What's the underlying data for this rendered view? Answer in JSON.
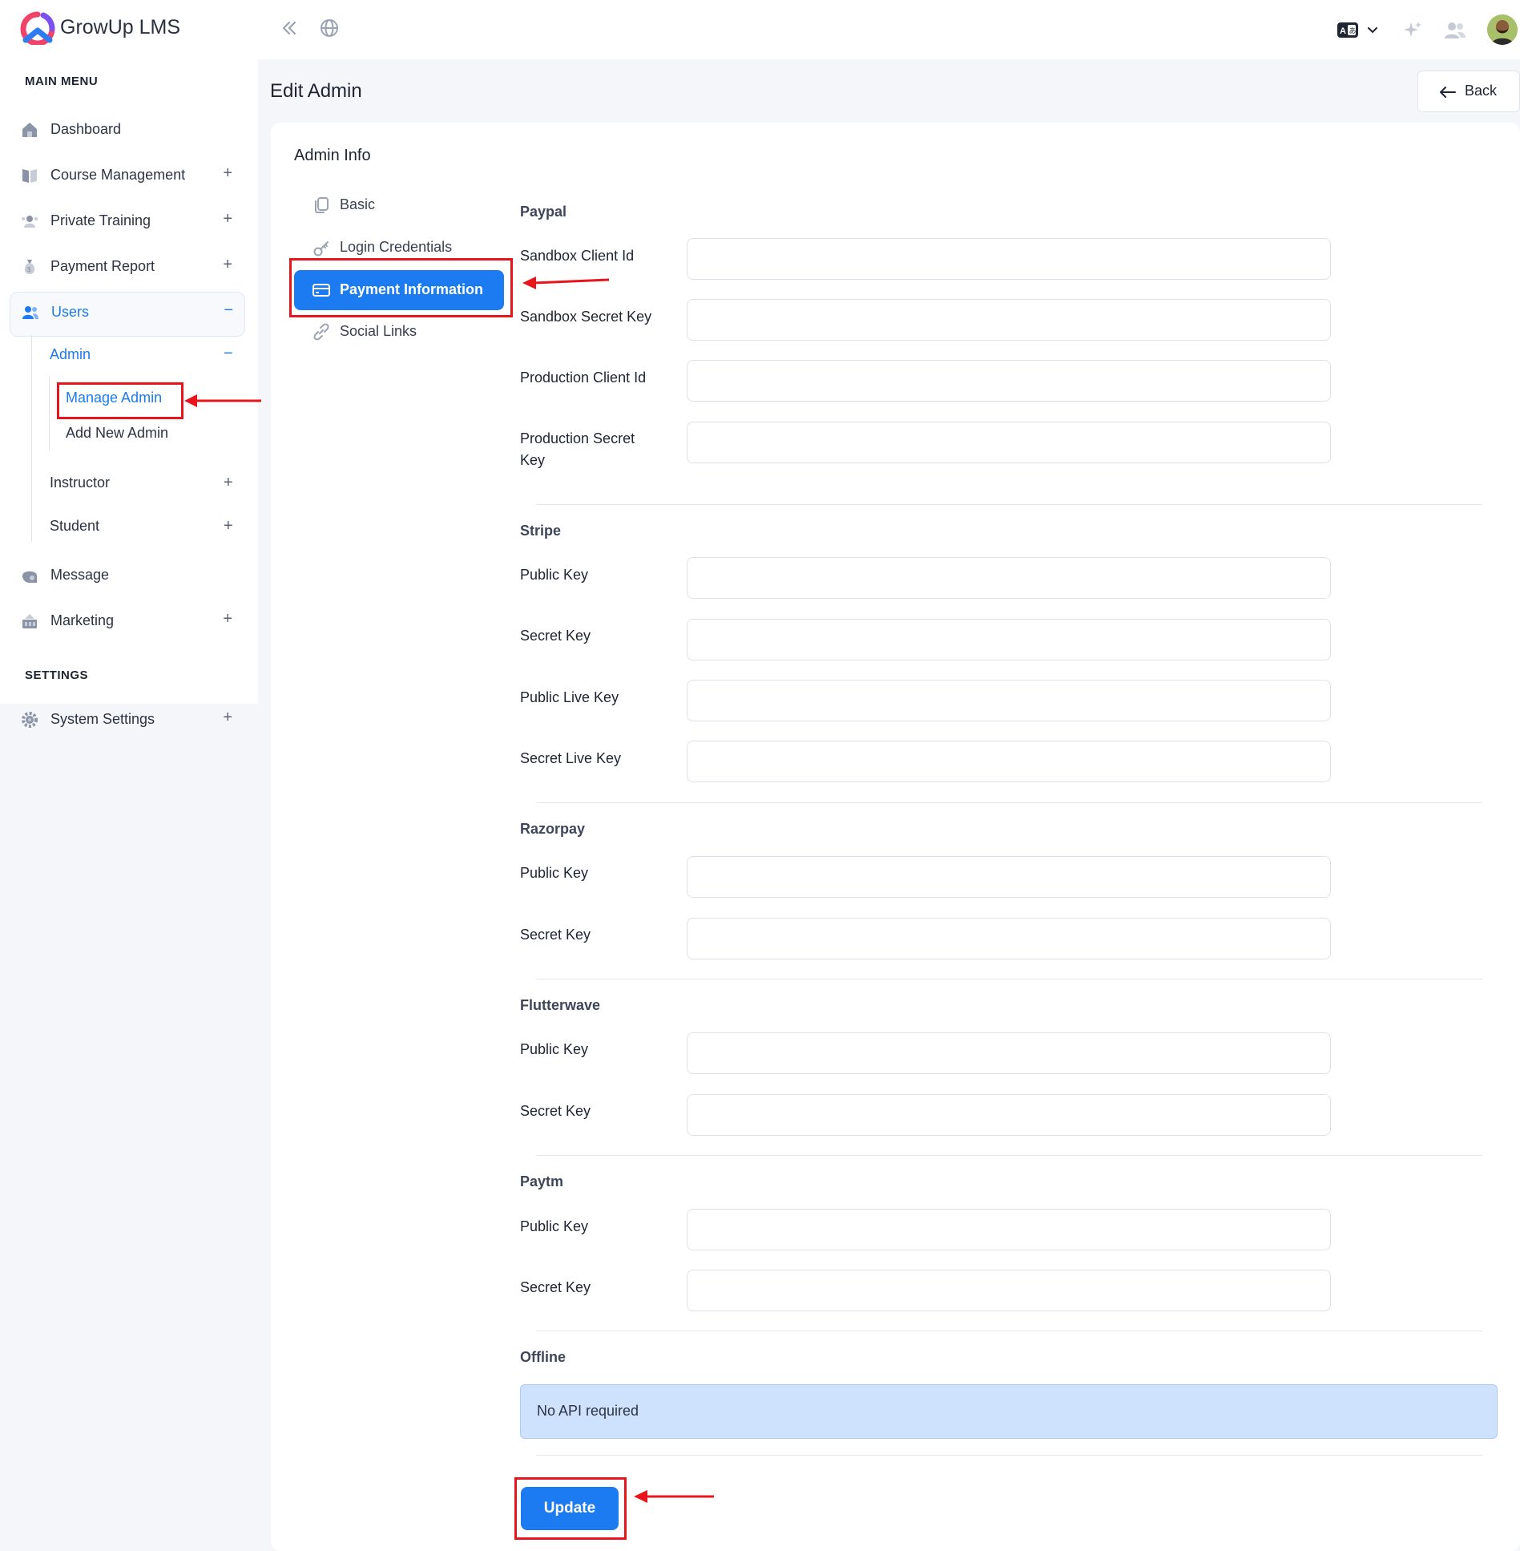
{
  "app": {
    "brand": "GrowUp LMS"
  },
  "sidebar": {
    "main_menu_heading": "MAIN MENU",
    "settings_heading": "SETTINGS",
    "items": [
      {
        "label": "Dashboard",
        "icon": "home-icon",
        "toggle": ""
      },
      {
        "label": "Course Management",
        "icon": "book-icon",
        "toggle": "+"
      },
      {
        "label": "Private Training",
        "icon": "training-icon",
        "toggle": "+"
      },
      {
        "label": "Payment Report",
        "icon": "money-bag-icon",
        "toggle": "+"
      },
      {
        "label": "Users",
        "icon": "users-icon",
        "toggle": "−"
      },
      {
        "label": "Message",
        "icon": "message-icon",
        "toggle": ""
      },
      {
        "label": "Marketing",
        "icon": "marketing-icon",
        "toggle": "+"
      },
      {
        "label": "System Settings",
        "icon": "gear-icon",
        "toggle": "+"
      }
    ],
    "users_sub": {
      "admin": {
        "label": "Admin",
        "toggle": "−"
      },
      "admin_children": [
        "Manage Admin",
        "Add New Admin"
      ],
      "instructor": {
        "label": "Instructor",
        "toggle": "+"
      },
      "student": {
        "label": "Student",
        "toggle": "+"
      }
    }
  },
  "header": {
    "page_title": "Edit Admin",
    "back_label": "Back"
  },
  "card": {
    "title": "Admin Info",
    "tabs": [
      {
        "label": "Basic",
        "icon": "copy-icon"
      },
      {
        "label": "Login Credentials",
        "icon": "key-icon"
      },
      {
        "label": "Payment Information",
        "icon": "credit-card-icon"
      },
      {
        "label": "Social Links",
        "icon": "link-icon"
      }
    ],
    "active_tab": "Payment Information"
  },
  "payment": {
    "paypal": {
      "title": "Paypal",
      "fields": [
        "Sandbox Client Id",
        "Sandbox Secret Key",
        "Production Client Id",
        "Production Secret Key"
      ]
    },
    "stripe": {
      "title": "Stripe",
      "fields": [
        "Public Key",
        "Secret Key",
        "Public Live Key",
        "Secret Live Key"
      ]
    },
    "razorpay": {
      "title": "Razorpay",
      "fields": [
        "Public Key",
        "Secret Key"
      ]
    },
    "flutterwave": {
      "title": "Flutterwave",
      "fields": [
        "Public Key",
        "Secret Key"
      ]
    },
    "paytm": {
      "title": "Paytm",
      "fields": [
        "Public Key",
        "Secret Key"
      ]
    },
    "offline": {
      "title": "Offline",
      "note": "No API required"
    }
  },
  "actions": {
    "update_label": "Update"
  },
  "colors": {
    "primary": "#1c7bf0",
    "highlight": "#e8161c",
    "offline_bg": "#cfe2fd"
  }
}
